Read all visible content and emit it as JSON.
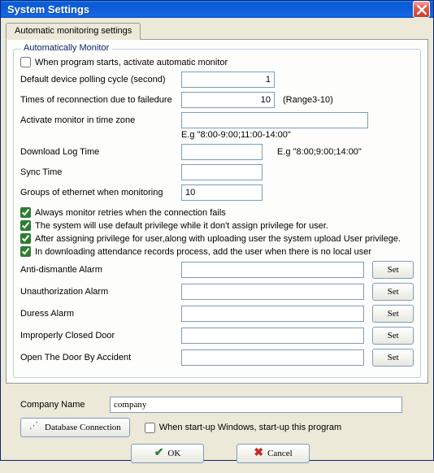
{
  "window": {
    "title": "System Settings"
  },
  "tab": {
    "label": "Automatic monitoring settings"
  },
  "group": {
    "title": "Automatically Monitor",
    "startup_checkbox": "When program starts, activate automatic monitor",
    "polling_label": "Default device polling cycle (second)",
    "polling_value": "1",
    "reconnect_label": "Times of reconnection due to failedure",
    "reconnect_value": "10",
    "reconnect_hint": "(Range3-10)",
    "zone_label": "Activate monitor in time zone",
    "zone_value": "",
    "zone_hint": "E.g \"8:00-9:00;11:00-14:00\"",
    "dlog_label": "Download Log Time",
    "dlog_value": "",
    "dlog_hint": "E.g \"8:00;9:00;14:00\"",
    "sync_label": "Sync Time",
    "sync_value": "",
    "groups_label": "Groups of ethernet when monitoring",
    "groups_value": "10",
    "cb1": "Always monitor retries when the connection fails",
    "cb2": "The system will use default privilege while it don't assign privilege for user.",
    "cb3": "After assigning privilege for user,along with uploading user the system upload User privilege.",
    "cb4": "In downloading attendance records process, add the user when there is no local user",
    "alarm1_label": "Anti-dismantle Alarm",
    "alarm2_label": "Unauthorization Alarm",
    "alarm3_label": "Duress Alarm",
    "alarm4_label": "Improperly Closed Door",
    "alarm5_label": "Open The Door By Accident",
    "set_label": "Set"
  },
  "bottom": {
    "company_label": "Company Name",
    "company_value": "company",
    "dbconn_label": "Database Connection",
    "startup_win": "When start-up Windows, start-up this program",
    "ok": "OK",
    "cancel": "Cancel"
  }
}
